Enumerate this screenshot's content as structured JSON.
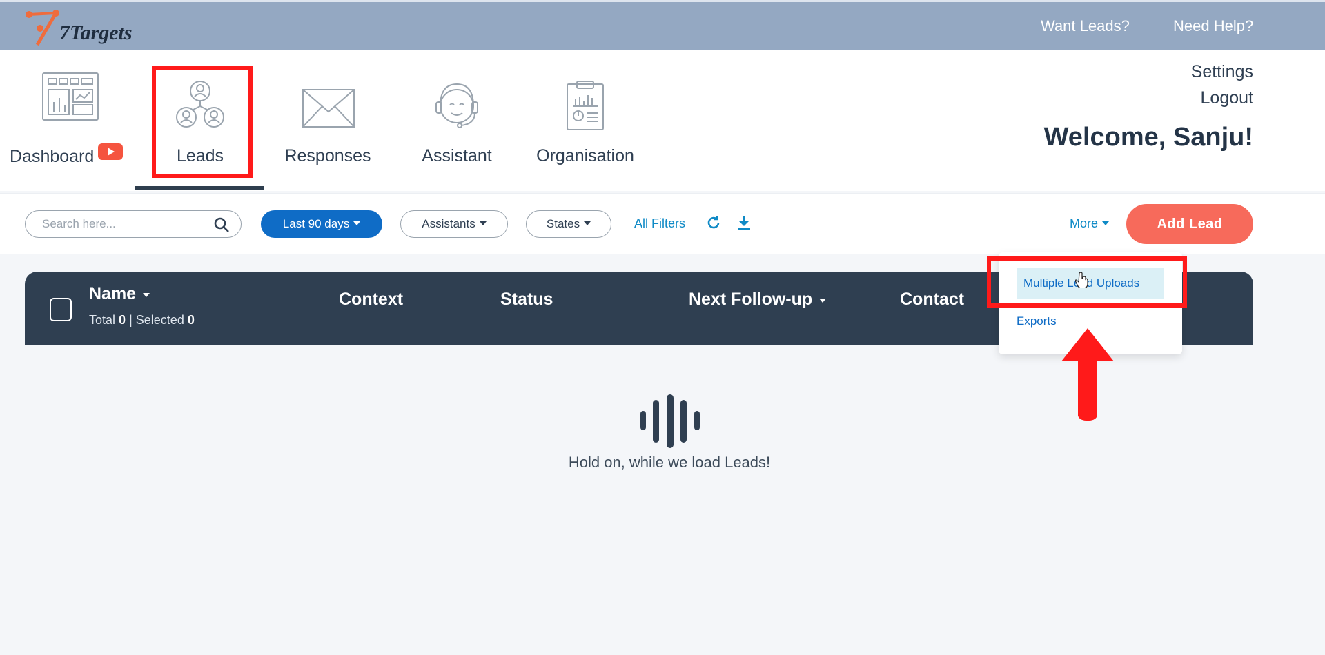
{
  "app": {
    "logo_text": "7Targets"
  },
  "topbar": {
    "want_leads": "Want Leads?",
    "need_help": "Need Help?"
  },
  "nav": {
    "items": [
      {
        "label": "Dashboard"
      },
      {
        "label": "Leads"
      },
      {
        "label": "Responses"
      },
      {
        "label": "Assistant"
      },
      {
        "label": "Organisation"
      }
    ],
    "active": "Leads"
  },
  "account": {
    "settings": "Settings",
    "logout": "Logout",
    "welcome": "Welcome, Sanju!"
  },
  "filters": {
    "search_placeholder": "Search here...",
    "date_range": "Last 90 days",
    "assistants": "Assistants",
    "states": "States",
    "all_filters": "All Filters",
    "more": "More",
    "add_lead": "Add Lead"
  },
  "table": {
    "columns": [
      "Name",
      "Context",
      "Status",
      "Next Follow-up",
      "Contact"
    ],
    "total_label": "Total",
    "total": "0",
    "selected_label": "Selected",
    "selected": "0"
  },
  "more_menu": {
    "items": [
      "Multiple Lead Uploads",
      "Exports"
    ],
    "highlighted": "Multiple Lead Uploads"
  },
  "loading": {
    "message": "Hold on, while we load Leads!"
  },
  "colors": {
    "topbar": "#94a8c2",
    "primary_blue": "#0f6cc6",
    "add_lead": "#f76a5b",
    "table_header": "#2f3f51",
    "annotation_red": "#ff1a1a"
  }
}
